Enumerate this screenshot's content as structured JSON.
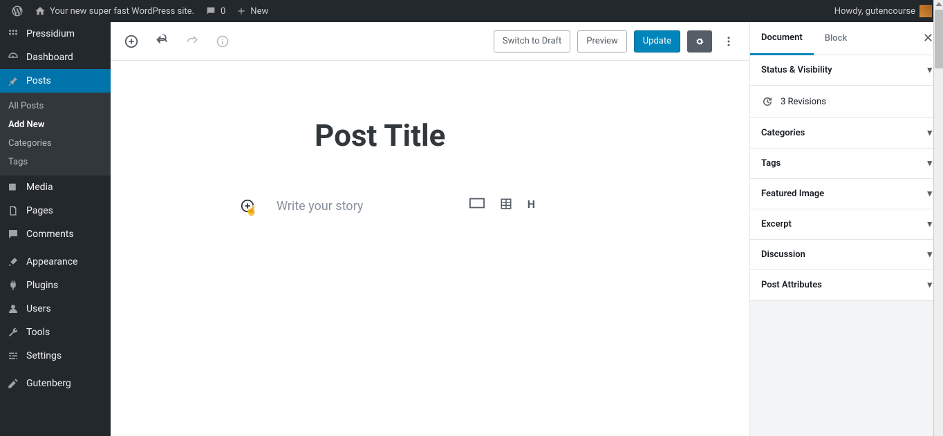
{
  "adminbar": {
    "site_name": "Your new super fast WordPress site.",
    "comment_count": "0",
    "new_label": "New",
    "howdy": "Howdy, gutencourse"
  },
  "adminmenu": {
    "pressidium": "Pressidium",
    "dashboard": "Dashboard",
    "posts": "Posts",
    "posts_sub": {
      "all": "All Posts",
      "add_new": "Add New",
      "categories": "Categories",
      "tags": "Tags"
    },
    "media": "Media",
    "pages": "Pages",
    "comments": "Comments",
    "appearance": "Appearance",
    "plugins": "Plugins",
    "users": "Users",
    "tools": "Tools",
    "settings": "Settings",
    "gutenberg": "Gutenberg"
  },
  "editor_header": {
    "switch_draft": "Switch to Draft",
    "preview": "Preview",
    "update": "Update"
  },
  "editor": {
    "title_value": "Post Title",
    "story_placeholder": "Write your story",
    "block_heading_glyph": "H"
  },
  "sidebar": {
    "tabs": {
      "document": "Document",
      "block": "Block"
    },
    "panels": {
      "status": "Status & Visibility",
      "revisions": "3 Revisions",
      "categories": "Categories",
      "tags": "Tags",
      "featured": "Featured Image",
      "excerpt": "Excerpt",
      "discussion": "Discussion",
      "attributes": "Post Attributes"
    }
  }
}
